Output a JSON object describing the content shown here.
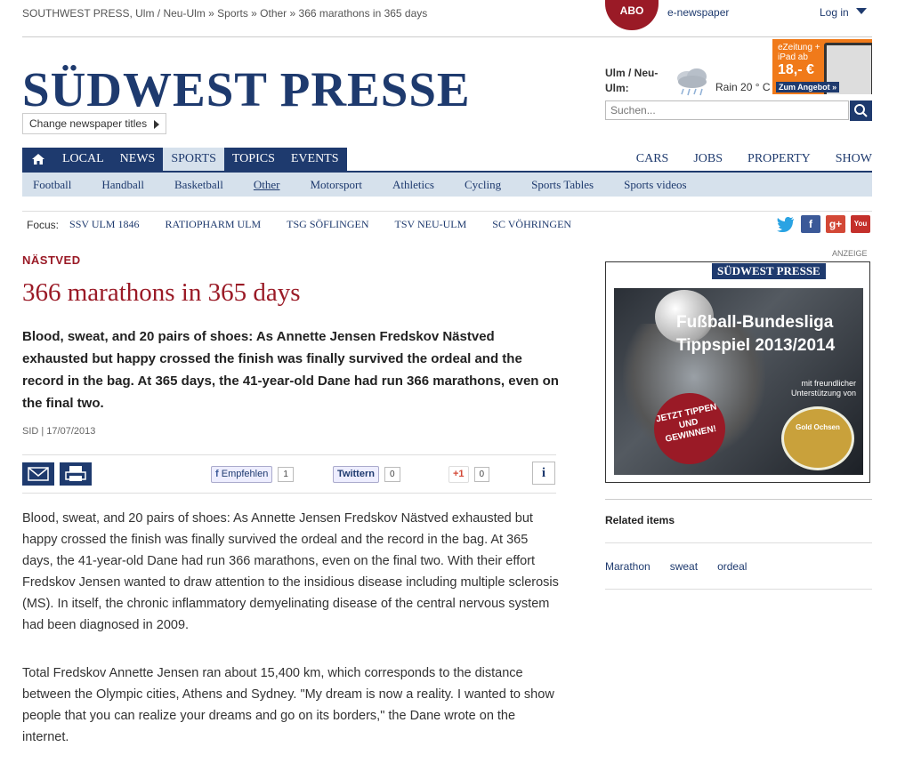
{
  "breadcrumb": "SOUTHWEST PRESS, Ulm / Neu-Ulm » Sports » Other » 366 marathons in 365 days",
  "header": {
    "abo": "ABO",
    "enewspaper": "e-newspaper",
    "login": "Log in",
    "logo": "SÜDWEST PRESSE",
    "change_titles": "Change newspaper titles",
    "weather_city": "Ulm / Neu-Ulm:",
    "weather": "Rain 20 ° C",
    "promo_text": "eZeitung + iPad ab",
    "promo_price": "18,- €",
    "promo_cta": "Zum Angebot »",
    "search_placeholder": "Suchen..."
  },
  "nav": {
    "items": [
      "LOCAL",
      "NEWS",
      "SPORTS",
      "TOPICS",
      "EVENTS"
    ],
    "right": [
      "CARS",
      "JOBS",
      "PROPERTY",
      "SHOW"
    ],
    "sub": [
      "Football",
      "Handball",
      "Basketball",
      "Other",
      "Motorsport",
      "Athletics",
      "Cycling",
      "Sports Tables",
      "Sports videos"
    ]
  },
  "focus": {
    "label": "Focus:",
    "items": [
      "SSV ULM 1846",
      "RATIOPHARM ULM",
      "TSG SÖFLINGEN",
      "TSV NEU-ULM",
      "SC VÖHRINGEN"
    ]
  },
  "article": {
    "kicker": "NÄSTVED",
    "headline": "366 marathons in 365 days",
    "lead": "Blood, sweat, and 20 pairs of shoes: As Annette Jensen Fredskov Nästved exhausted but happy crossed the finish was finally survived the ordeal and the record in the bag. At 365 days, the 41-year-old Dane had run 366 marathons, even on the final two.",
    "meta": "SID | 17/07/2013",
    "share": {
      "facebook": "Empfehlen",
      "facebook_count": "1",
      "twitter": "Twittern",
      "twitter_count": "0",
      "gplus": "+1",
      "gplus_count": "0"
    },
    "info": "i",
    "paragraphs": [
      "Blood, sweat, and 20 pairs of shoes: As Annette Jensen Fredskov Nästved exhausted but happy crossed the finish was finally survived the ordeal and the record in the bag. At 365 days, the 41-year-old Dane had run 366 marathons, even on the final two. With their effort Fredskov Jensen wanted to draw attention to the insidious disease including multiple sclerosis (MS). In itself, the chronic inflammatory demyelinating disease of the central nervous system had been diagnosed in 2009.",
      "Total Fredskov Annette Jensen ran about 15,400 km, which corresponds to the distance between the Olympic cities, Athens and Sydney. \"My dream is now a reality. I wanted to show people that you can realize your dreams and go on its borders,\" the Dane wrote on the internet."
    ]
  },
  "sidebar": {
    "anzeige": "ANZEIGE",
    "ad_brand": "SÜDWEST PRESSE",
    "ad_title1": "Fußball-Bundesliga",
    "ad_title2": "Tippspiel 2013/2014",
    "ad_support": "mit freundlicher Unterstützung von",
    "ad_badge": "JETZT TIPPEN UND GEWINNEN!",
    "ad_logo": "Gold Ochsen",
    "related_title": "Related items",
    "tags": [
      "Marathon",
      "sweat",
      "ordeal"
    ]
  }
}
